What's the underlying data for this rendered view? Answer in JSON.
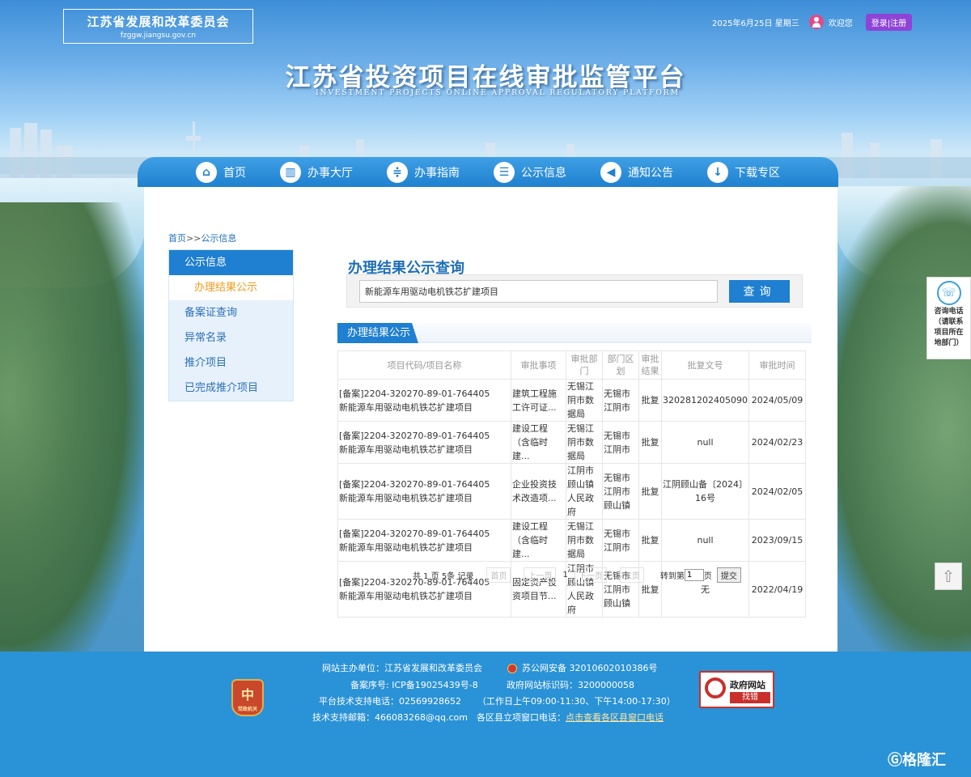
{
  "header": {
    "org_name": "江苏省发展和改革委员会",
    "org_url": "fzggw.jiangsu.gov.cn",
    "date": "2025年6月25日 星期三",
    "welcome": "欢迎您",
    "login_label": "登录|注册",
    "platform_title": "江苏省投资项目在线审批监管平台",
    "platform_subtitle": "INVESTMENT PROJECTS ONLINE APPROVAL REGULATORY PLATFORM"
  },
  "nav": [
    {
      "label": "首页",
      "icon": "home-icon"
    },
    {
      "label": "办事大厅",
      "icon": "book-icon"
    },
    {
      "label": "办事指南",
      "icon": "guide-icon"
    },
    {
      "label": "公示信息",
      "icon": "message-icon"
    },
    {
      "label": "通知公告",
      "icon": "megaphone-icon"
    },
    {
      "label": "下载专区",
      "icon": "download-icon"
    }
  ],
  "breadcrumb": {
    "home": "首页",
    "sep": ">>",
    "current": "公示信息"
  },
  "sidebar": {
    "title": "公示信息",
    "items": [
      "办理结果公示",
      "备案证查询",
      "异常名录",
      "推介项目",
      "已完成推介项目"
    ]
  },
  "query": {
    "title": "办理结果公示查询",
    "value": "新能源车用驱动电机铁芯扩建项目",
    "button": "查询"
  },
  "results": {
    "tab_label": "办理结果公示",
    "columns": [
      "项目代码/项目名称",
      "审批事项",
      "审批部门",
      "部门区划",
      "审批结果",
      "批复文号",
      "审批时间"
    ],
    "rows": [
      {
        "code": "[备案]2204-320270-89-01-764405",
        "name": "新能源车用驱动电机铁芯扩建项目",
        "item": "建筑工程施工许可证...",
        "dept": "无锡江阴市数据局",
        "region": "无锡市江阴市",
        "result": "批复",
        "doc": "320281202405090...",
        "date": "2024/05/09"
      },
      {
        "code": "[备案]2204-320270-89-01-764405",
        "name": "新能源车用驱动电机铁芯扩建项目",
        "item": "建设工程（含临时建...",
        "dept": "无锡江阴市数据局",
        "region": "无锡市江阴市",
        "result": "批复",
        "doc": "null",
        "date": "2024/02/23"
      },
      {
        "code": "[备案]2204-320270-89-01-764405",
        "name": "新能源车用驱动电机铁芯扩建项目",
        "item": "企业投资技术改造项...",
        "dept": "江阴市顾山镇人民政府",
        "region": "无锡市江阴市顾山镇",
        "result": "批复",
        "doc": "江阴顾山备〔2024〕16号",
        "date": "2024/02/05"
      },
      {
        "code": "[备案]2204-320270-89-01-764405",
        "name": "新能源车用驱动电机铁芯扩建项目",
        "item": "建设工程（含临时建...",
        "dept": "无锡江阴市数据局",
        "region": "无锡市江阴市",
        "result": "批复",
        "doc": "null",
        "date": "2023/09/15"
      },
      {
        "code": "[备案]2204-320270-89-01-764405",
        "name": "新能源车用驱动电机铁芯扩建项目",
        "item": "固定资产投资项目节...",
        "dept": "江阴市顾山镇人民政府",
        "region": "无锡市江阴市顾山镇",
        "result": "批复",
        "doc": "无",
        "date": "2022/04/19"
      }
    ]
  },
  "pager": {
    "total_text": "共 1 页 5条 记录",
    "first": "首页",
    "prev": "上一页",
    "current": "1",
    "next": "下一页",
    "last": "末页",
    "goto_prefix": "转到第",
    "goto_value": "1",
    "goto_suffix": "页",
    "submit": "提交"
  },
  "consult": {
    "line1": "咨询电话",
    "line2": "（请联系",
    "line3": "项目所在",
    "line4": "地部门）"
  },
  "footer": {
    "sponsor": "网站主办单位：江苏省发展和改革委员会",
    "police": "苏公网安备 32010602010386号",
    "icp": "备案序号:    ICP备19025439号-8",
    "gov_id": "政府网站标识码：3200000058",
    "tech_phone": "平台技术支持电话：02569928652",
    "hours": "（工作日上午09:00-11:30、下午14:00-17:30）",
    "tech_email": "技术支持邮箱：466083268@qq.com",
    "window_phone_label": "各区县立项窗口电话：",
    "window_phone_link": "点击查看各区县窗口电话",
    "badge_left": "党政机关",
    "gov_badge_t1": "政府网站",
    "gov_badge_t2": "找错"
  },
  "watermark": "格隆汇"
}
